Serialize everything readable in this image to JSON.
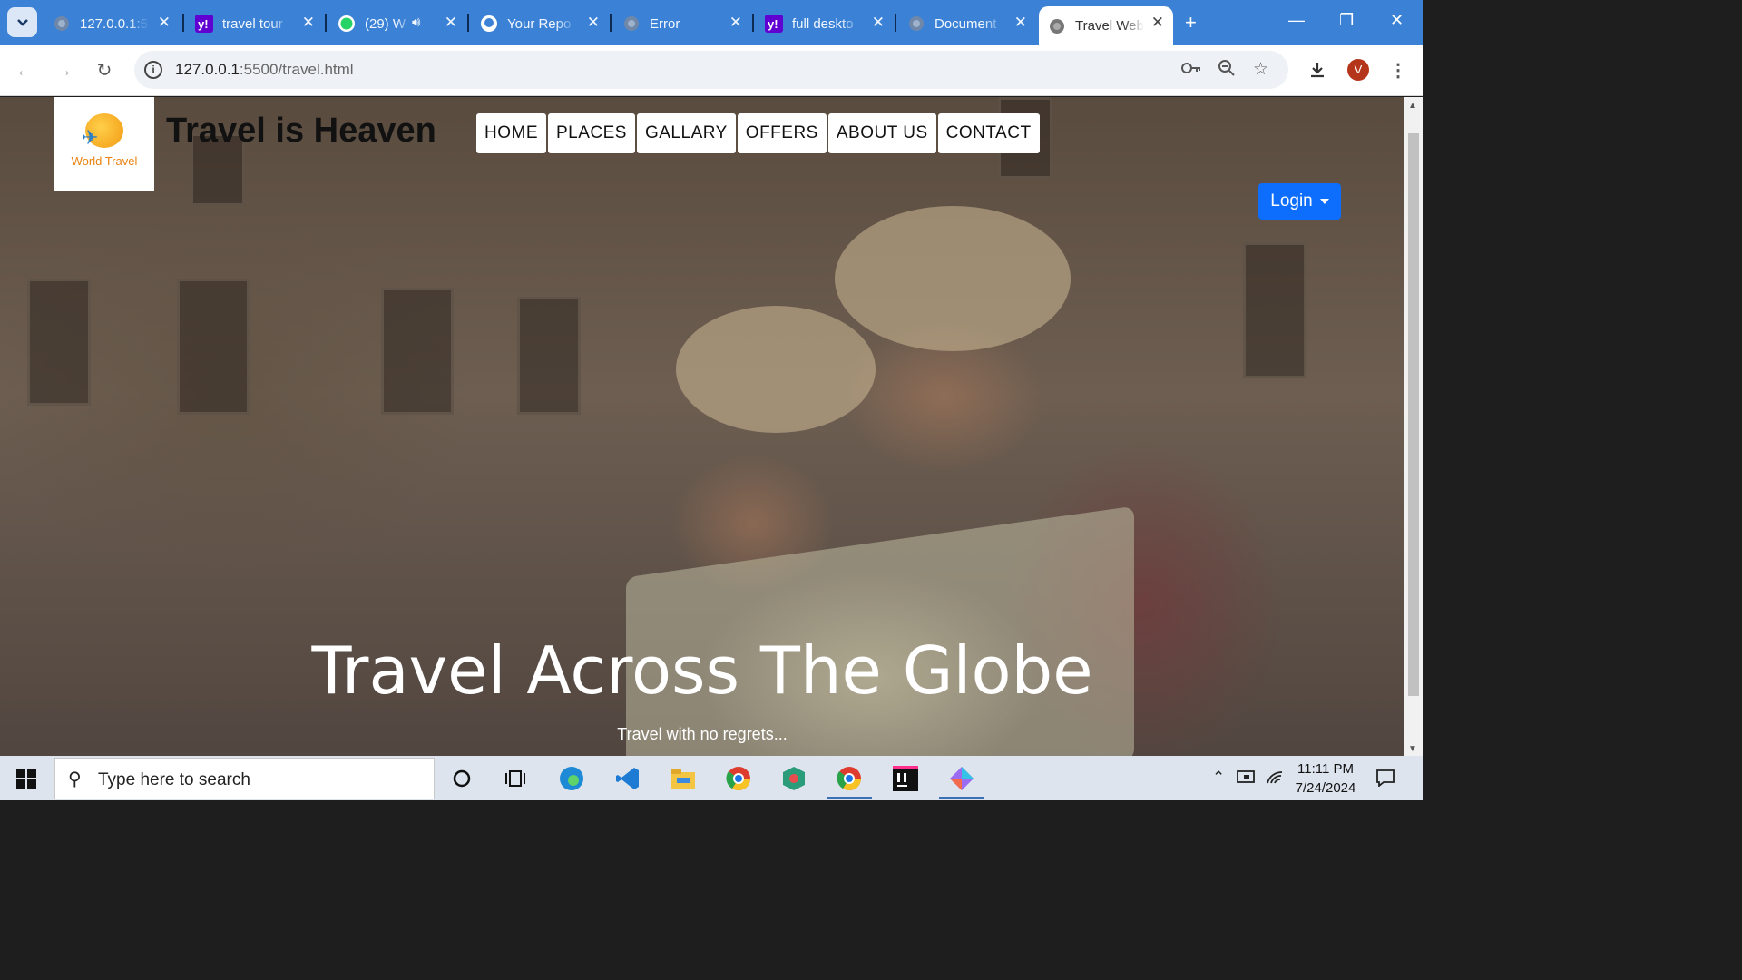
{
  "browser": {
    "tabs": [
      {
        "title": "127.0.0.1:5",
        "icon": "globe-icon"
      },
      {
        "title": "travel tour",
        "icon": "yahoo-icon"
      },
      {
        "title": "(29) W",
        "icon": "whatsapp-icon"
      },
      {
        "title": "Your Repo",
        "icon": "github-icon"
      },
      {
        "title": "Error",
        "icon": "globe-icon"
      },
      {
        "title": "full deskto",
        "icon": "yahoo-icon"
      },
      {
        "title": "Document",
        "icon": "globe-icon"
      },
      {
        "title": "Travel Web",
        "icon": "globe-icon",
        "active": true
      }
    ],
    "url_host": "127.0.0.1",
    "url_rest": ":5500/travel.html",
    "profile_initial": "V"
  },
  "site": {
    "logo_text": "World Travel",
    "title": "Travel is Heaven",
    "nav": [
      "HOME",
      "PLACES",
      "GALLARY",
      "OFFERS",
      "ABOUT US",
      "CONTACT"
    ],
    "login_label": "Login",
    "hero_title": "Travel Across The Globe",
    "hero_subtitle": "Travel with no regrets..."
  },
  "taskbar": {
    "search_placeholder": "Type here to search",
    "time": "11:11 PM",
    "date": "7/24/2024"
  },
  "colors": {
    "tabbar": "#3b82d6",
    "login_button": "#0d6efd",
    "logo_orange": "#e8830f"
  }
}
